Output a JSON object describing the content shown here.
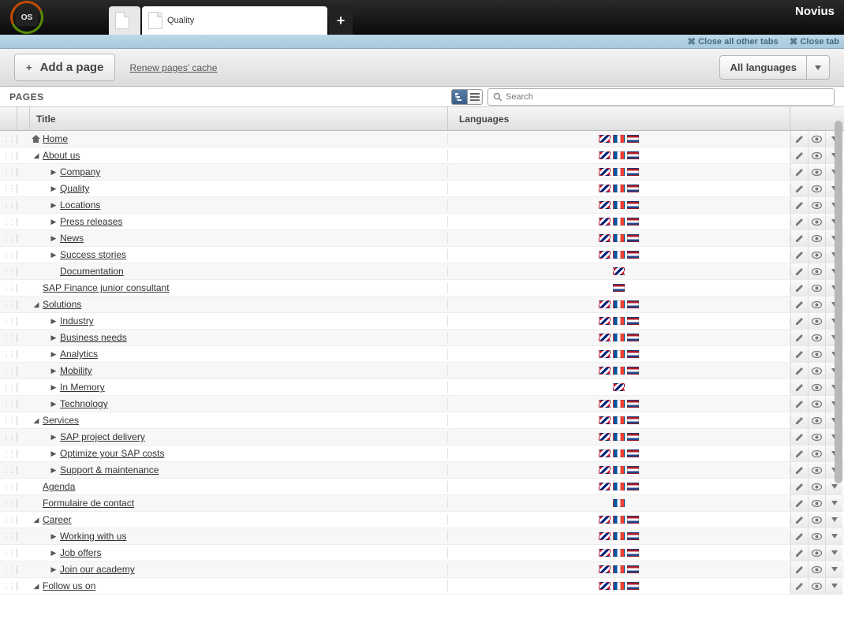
{
  "brand": "Novius",
  "os_label": "OS",
  "tabs": {
    "active_label": "Quality",
    "add_glyph": "+"
  },
  "subbar": {
    "close_others": "Close all other tabs",
    "close_tab": "Close tab"
  },
  "toolbar": {
    "add_page": "Add a page",
    "plus": "+",
    "renew_cache": "Renew pages' cache",
    "lang_selector": "All languages"
  },
  "pages_header": {
    "title": "PAGES",
    "search_placeholder": "Search"
  },
  "columns": {
    "title": "Title",
    "languages": "Languages"
  },
  "rows": [
    {
      "depth": 0,
      "arrow": "home",
      "label": "Home",
      "flags": [
        "gb",
        "fr",
        "nl"
      ]
    },
    {
      "depth": 0,
      "arrow": "open",
      "label": "About us",
      "flags": [
        "gb",
        "fr",
        "nl"
      ]
    },
    {
      "depth": 1,
      "arrow": "closed",
      "label": "Company",
      "flags": [
        "gb",
        "fr",
        "nl"
      ]
    },
    {
      "depth": 1,
      "arrow": "closed",
      "label": "Quality",
      "flags": [
        "gb",
        "fr",
        "nl"
      ]
    },
    {
      "depth": 1,
      "arrow": "closed",
      "label": "Locations",
      "flags": [
        "gb",
        "fr",
        "nl"
      ]
    },
    {
      "depth": 1,
      "arrow": "closed",
      "label": "Press releases",
      "flags": [
        "gb",
        "fr",
        "nl"
      ]
    },
    {
      "depth": 1,
      "arrow": "closed",
      "label": "News",
      "flags": [
        "gb",
        "fr",
        "nl"
      ]
    },
    {
      "depth": 1,
      "arrow": "closed",
      "label": "Success stories",
      "flags": [
        "gb",
        "fr",
        "nl"
      ]
    },
    {
      "depth": 1,
      "arrow": "none",
      "label": "Documentation",
      "flags": [
        "gb"
      ]
    },
    {
      "depth": 0,
      "arrow": "none",
      "label": "SAP Finance junior consultant",
      "flags": [
        "nl"
      ]
    },
    {
      "depth": 0,
      "arrow": "open",
      "label": "Solutions",
      "flags": [
        "gb",
        "fr",
        "nl"
      ]
    },
    {
      "depth": 1,
      "arrow": "closed",
      "label": "Industry",
      "flags": [
        "gb",
        "fr",
        "nl"
      ]
    },
    {
      "depth": 1,
      "arrow": "closed",
      "label": "Business needs",
      "flags": [
        "gb",
        "fr",
        "nl"
      ]
    },
    {
      "depth": 1,
      "arrow": "closed",
      "label": "Analytics",
      "flags": [
        "gb",
        "fr",
        "nl"
      ]
    },
    {
      "depth": 1,
      "arrow": "closed",
      "label": "Mobility",
      "flags": [
        "gb",
        "fr",
        "nl"
      ]
    },
    {
      "depth": 1,
      "arrow": "closed",
      "label": "In Memory",
      "flags": [
        "gb"
      ]
    },
    {
      "depth": 1,
      "arrow": "closed",
      "label": "Technology",
      "flags": [
        "gb",
        "fr",
        "nl"
      ]
    },
    {
      "depth": 0,
      "arrow": "open",
      "label": "Services",
      "flags": [
        "gb",
        "fr",
        "nl"
      ]
    },
    {
      "depth": 1,
      "arrow": "closed",
      "label": "SAP project delivery",
      "flags": [
        "gb",
        "fr",
        "nl"
      ]
    },
    {
      "depth": 1,
      "arrow": "closed",
      "label": "Optimize your SAP costs",
      "flags": [
        "gb",
        "fr",
        "nl"
      ]
    },
    {
      "depth": 1,
      "arrow": "closed",
      "label": "Support & maintenance",
      "flags": [
        "gb",
        "fr",
        "nl"
      ]
    },
    {
      "depth": 0,
      "arrow": "none",
      "label": "Agenda",
      "flags": [
        "gb",
        "fr",
        "nl"
      ]
    },
    {
      "depth": 0,
      "arrow": "none",
      "label": "Formulaire de contact",
      "flags": [
        "fr"
      ]
    },
    {
      "depth": 0,
      "arrow": "open",
      "label": "Career",
      "flags": [
        "gb",
        "fr",
        "nl"
      ]
    },
    {
      "depth": 1,
      "arrow": "closed",
      "label": "Working with us",
      "flags": [
        "gb",
        "fr",
        "nl"
      ]
    },
    {
      "depth": 1,
      "arrow": "closed",
      "label": "Job offers",
      "flags": [
        "gb",
        "fr",
        "nl"
      ]
    },
    {
      "depth": 1,
      "arrow": "closed",
      "label": "Join our academy",
      "flags": [
        "gb",
        "fr",
        "nl"
      ]
    },
    {
      "depth": 0,
      "arrow": "open",
      "label": "Follow us on",
      "flags": [
        "gb",
        "fr",
        "nl"
      ]
    }
  ]
}
